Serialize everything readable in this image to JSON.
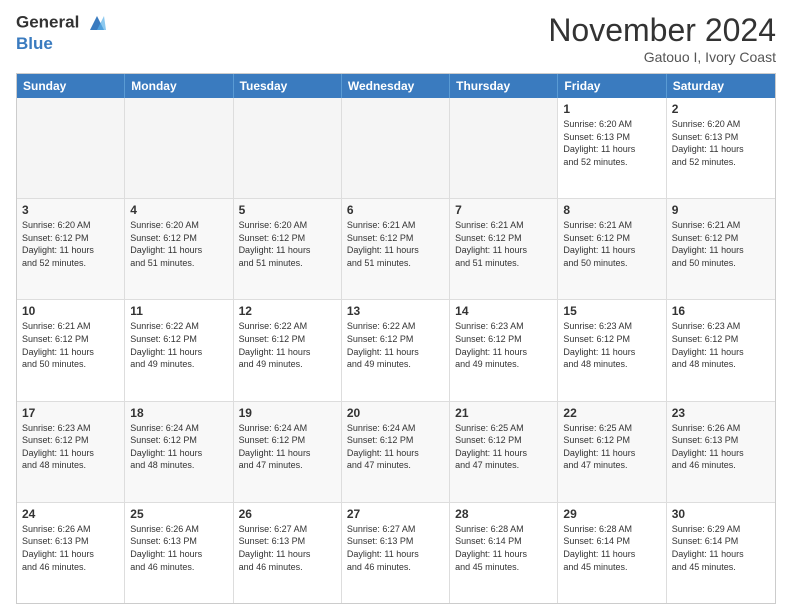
{
  "header": {
    "logo_line1": "General",
    "logo_line2": "Blue",
    "month": "November 2024",
    "location": "Gatouo I, Ivory Coast"
  },
  "days_of_week": [
    "Sunday",
    "Monday",
    "Tuesday",
    "Wednesday",
    "Thursday",
    "Friday",
    "Saturday"
  ],
  "rows": [
    [
      {
        "day": "",
        "info": "",
        "empty": true
      },
      {
        "day": "",
        "info": "",
        "empty": true
      },
      {
        "day": "",
        "info": "",
        "empty": true
      },
      {
        "day": "",
        "info": "",
        "empty": true
      },
      {
        "day": "",
        "info": "",
        "empty": true
      },
      {
        "day": "1",
        "info": "Sunrise: 6:20 AM\nSunset: 6:13 PM\nDaylight: 11 hours\nand 52 minutes.",
        "empty": false
      },
      {
        "day": "2",
        "info": "Sunrise: 6:20 AM\nSunset: 6:13 PM\nDaylight: 11 hours\nand 52 minutes.",
        "empty": false
      }
    ],
    [
      {
        "day": "3",
        "info": "Sunrise: 6:20 AM\nSunset: 6:12 PM\nDaylight: 11 hours\nand 52 minutes.",
        "empty": false
      },
      {
        "day": "4",
        "info": "Sunrise: 6:20 AM\nSunset: 6:12 PM\nDaylight: 11 hours\nand 51 minutes.",
        "empty": false
      },
      {
        "day": "5",
        "info": "Sunrise: 6:20 AM\nSunset: 6:12 PM\nDaylight: 11 hours\nand 51 minutes.",
        "empty": false
      },
      {
        "day": "6",
        "info": "Sunrise: 6:21 AM\nSunset: 6:12 PM\nDaylight: 11 hours\nand 51 minutes.",
        "empty": false
      },
      {
        "day": "7",
        "info": "Sunrise: 6:21 AM\nSunset: 6:12 PM\nDaylight: 11 hours\nand 51 minutes.",
        "empty": false
      },
      {
        "day": "8",
        "info": "Sunrise: 6:21 AM\nSunset: 6:12 PM\nDaylight: 11 hours\nand 50 minutes.",
        "empty": false
      },
      {
        "day": "9",
        "info": "Sunrise: 6:21 AM\nSunset: 6:12 PM\nDaylight: 11 hours\nand 50 minutes.",
        "empty": false
      }
    ],
    [
      {
        "day": "10",
        "info": "Sunrise: 6:21 AM\nSunset: 6:12 PM\nDaylight: 11 hours\nand 50 minutes.",
        "empty": false
      },
      {
        "day": "11",
        "info": "Sunrise: 6:22 AM\nSunset: 6:12 PM\nDaylight: 11 hours\nand 49 minutes.",
        "empty": false
      },
      {
        "day": "12",
        "info": "Sunrise: 6:22 AM\nSunset: 6:12 PM\nDaylight: 11 hours\nand 49 minutes.",
        "empty": false
      },
      {
        "day": "13",
        "info": "Sunrise: 6:22 AM\nSunset: 6:12 PM\nDaylight: 11 hours\nand 49 minutes.",
        "empty": false
      },
      {
        "day": "14",
        "info": "Sunrise: 6:23 AM\nSunset: 6:12 PM\nDaylight: 11 hours\nand 49 minutes.",
        "empty": false
      },
      {
        "day": "15",
        "info": "Sunrise: 6:23 AM\nSunset: 6:12 PM\nDaylight: 11 hours\nand 48 minutes.",
        "empty": false
      },
      {
        "day": "16",
        "info": "Sunrise: 6:23 AM\nSunset: 6:12 PM\nDaylight: 11 hours\nand 48 minutes.",
        "empty": false
      }
    ],
    [
      {
        "day": "17",
        "info": "Sunrise: 6:23 AM\nSunset: 6:12 PM\nDaylight: 11 hours\nand 48 minutes.",
        "empty": false
      },
      {
        "day": "18",
        "info": "Sunrise: 6:24 AM\nSunset: 6:12 PM\nDaylight: 11 hours\nand 48 minutes.",
        "empty": false
      },
      {
        "day": "19",
        "info": "Sunrise: 6:24 AM\nSunset: 6:12 PM\nDaylight: 11 hours\nand 47 minutes.",
        "empty": false
      },
      {
        "day": "20",
        "info": "Sunrise: 6:24 AM\nSunset: 6:12 PM\nDaylight: 11 hours\nand 47 minutes.",
        "empty": false
      },
      {
        "day": "21",
        "info": "Sunrise: 6:25 AM\nSunset: 6:12 PM\nDaylight: 11 hours\nand 47 minutes.",
        "empty": false
      },
      {
        "day": "22",
        "info": "Sunrise: 6:25 AM\nSunset: 6:12 PM\nDaylight: 11 hours\nand 47 minutes.",
        "empty": false
      },
      {
        "day": "23",
        "info": "Sunrise: 6:26 AM\nSunset: 6:13 PM\nDaylight: 11 hours\nand 46 minutes.",
        "empty": false
      }
    ],
    [
      {
        "day": "24",
        "info": "Sunrise: 6:26 AM\nSunset: 6:13 PM\nDaylight: 11 hours\nand 46 minutes.",
        "empty": false
      },
      {
        "day": "25",
        "info": "Sunrise: 6:26 AM\nSunset: 6:13 PM\nDaylight: 11 hours\nand 46 minutes.",
        "empty": false
      },
      {
        "day": "26",
        "info": "Sunrise: 6:27 AM\nSunset: 6:13 PM\nDaylight: 11 hours\nand 46 minutes.",
        "empty": false
      },
      {
        "day": "27",
        "info": "Sunrise: 6:27 AM\nSunset: 6:13 PM\nDaylight: 11 hours\nand 46 minutes.",
        "empty": false
      },
      {
        "day": "28",
        "info": "Sunrise: 6:28 AM\nSunset: 6:14 PM\nDaylight: 11 hours\nand 45 minutes.",
        "empty": false
      },
      {
        "day": "29",
        "info": "Sunrise: 6:28 AM\nSunset: 6:14 PM\nDaylight: 11 hours\nand 45 minutes.",
        "empty": false
      },
      {
        "day": "30",
        "info": "Sunrise: 6:29 AM\nSunset: 6:14 PM\nDaylight: 11 hours\nand 45 minutes.",
        "empty": false
      }
    ]
  ]
}
